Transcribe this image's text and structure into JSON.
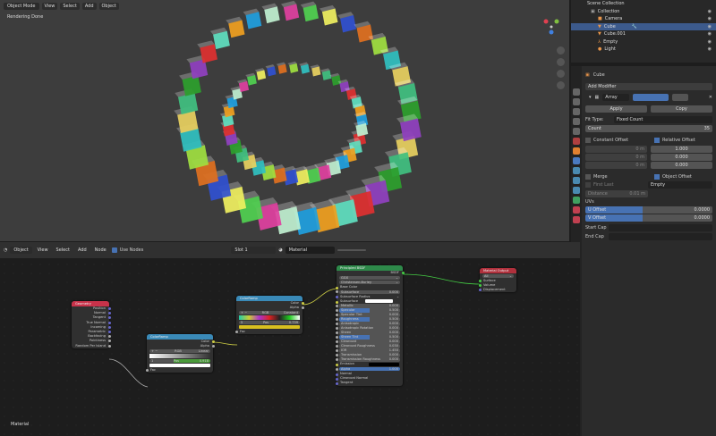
{
  "viewport": {
    "mode": "Object Mode",
    "menus": [
      "View",
      "Select",
      "Add",
      "Object"
    ],
    "status": "Rendering Done",
    "cube_colors": [
      "#e8d060",
      "#40c080",
      "#2ca02c",
      "#9040c0",
      "#e03030",
      "#60e0c0",
      "#f0a020",
      "#20a0e0",
      "#c0f0d0",
      "#e040a0",
      "#50d050",
      "#f0f060",
      "#3050d0",
      "#e07020",
      "#a0e040",
      "#30c0c0"
    ]
  },
  "outliner": {
    "root": "Scene Collection",
    "items": [
      {
        "label": "Collection"
      },
      {
        "label": "Camera"
      },
      {
        "label": "Cube",
        "selected": true
      },
      {
        "label": "Cube.001"
      },
      {
        "label": "Empty"
      },
      {
        "label": "Light"
      }
    ]
  },
  "properties": {
    "object": "Cube",
    "add_modifier": "Add Modifier",
    "modifier_name": "Array",
    "apply": "Apply",
    "copy": "Copy",
    "fit_type_label": "Fit Type:",
    "fit_type": "Fixed Count",
    "count_label": "Count",
    "count": "35",
    "constant_offset": "Constant Offset",
    "relative_offset": "Relative Offset",
    "const_vals": [
      "0 m",
      "0 m",
      "0 m"
    ],
    "rel_vals": [
      "1.000",
      "0.000",
      "0.000"
    ],
    "merge": "Merge",
    "first_last": "First Last",
    "distance_label": "Distance",
    "distance": "0.01 m",
    "object_offset": "Object Offset",
    "offset_object": "Empty",
    "uvs": "UVs",
    "u_offset": "U Offset",
    "u_value": "0.0000",
    "v_offset": "V Offset",
    "v_value": "0.0000",
    "start_cap": "Start Cap",
    "end_cap": "End Cap"
  },
  "node_editor": {
    "type": "Object",
    "menus": [
      "View",
      "Select",
      "Add",
      "Node"
    ],
    "use_nodes": "Use Nodes",
    "slot": "Slot 1",
    "material": "Material",
    "footer": "Material",
    "geometry": {
      "title": "Geometry",
      "outputs": [
        "Position",
        "Normal",
        "Tangent",
        "True Normal",
        "Incoming",
        "Parametric",
        "Backfacing",
        "Pointiness",
        "Random Per Island"
      ]
    },
    "ramp1": {
      "title": "ColorRamp",
      "outputs": [
        "Color",
        "Alpha"
      ],
      "mode": "RGB",
      "interp": "Linear",
      "index": "1",
      "pos_label": "Pos",
      "pos": "0.918",
      "input": "Fac"
    },
    "ramp2": {
      "title": "ColorRamp",
      "outputs": [
        "Color",
        "Alpha"
      ],
      "mode": "RGB",
      "interp": "Constant",
      "index": "5",
      "pos_label": "Pos",
      "pos": "0.739",
      "input": "Fac"
    },
    "bsdf": {
      "title": "Principled BSDF",
      "output": "BSDF",
      "distribution": "GGX",
      "sss_method": "Christensen-Burley",
      "rows": [
        {
          "label": "Base Color"
        },
        {
          "label": "Subsurface",
          "value": "0.000"
        },
        {
          "label": "Subsurface Radius",
          "dropdown": true
        },
        {
          "label": "Subsurface Color",
          "swatch": "#ffffff"
        },
        {
          "label": "Metallic",
          "value": "0.000"
        },
        {
          "label": "Specular",
          "value": "0.500",
          "fill": 50
        },
        {
          "label": "Specular Tint",
          "value": "0.000"
        },
        {
          "label": "Roughness",
          "value": "0.500",
          "fill": 50
        },
        {
          "label": "Anisotropic",
          "value": "0.000"
        },
        {
          "label": "Anisotropic Rotation",
          "value": "0.000"
        },
        {
          "label": "Sheen",
          "value": "0.000"
        },
        {
          "label": "Sheen Tint",
          "value": "0.500",
          "fill": 50
        },
        {
          "label": "Clearcoat",
          "value": "0.000"
        },
        {
          "label": "Clearcoat Roughness",
          "value": "0.030"
        },
        {
          "label": "IOR",
          "value": "1.450"
        },
        {
          "label": "Transmission",
          "value": "0.000"
        },
        {
          "label": "Transmission Roughness",
          "value": "0.000"
        },
        {
          "label": "Emission",
          "swatch": "#000000"
        },
        {
          "label": "Alpha",
          "value": "1.000",
          "fill": 100
        },
        {
          "label": "Normal"
        },
        {
          "label": "Clearcoat Normal"
        },
        {
          "label": "Tangent"
        }
      ]
    },
    "output": {
      "title": "Material Output",
      "target": "All",
      "inputs": [
        "Surface",
        "Volume",
        "Displacement"
      ]
    }
  }
}
